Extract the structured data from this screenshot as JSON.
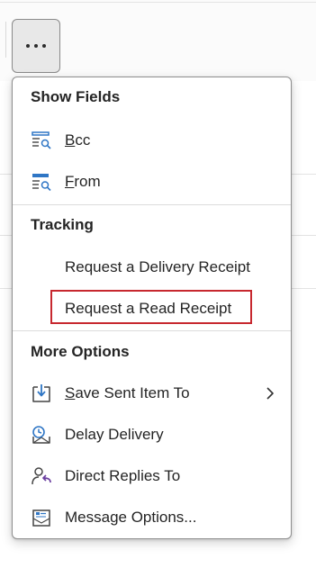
{
  "toolbar": {
    "more_icon": "ellipsis-icon"
  },
  "menu": {
    "sections": {
      "show_fields": {
        "title": "Show Fields",
        "items": {
          "bcc": {
            "mnemonic": "B",
            "rest": "cc",
            "icon": "bcc-fields-icon"
          },
          "from": {
            "mnemonic": "F",
            "rest": "rom",
            "icon": "from-fields-icon"
          }
        }
      },
      "tracking": {
        "title": "Tracking",
        "items": {
          "delivery_receipt": {
            "label": "Request a Delivery Receipt"
          },
          "read_receipt": {
            "label": "Request a Read Receipt",
            "highlighted": true
          }
        }
      },
      "more_options": {
        "title": "More Options",
        "items": {
          "save_sent": {
            "mnemonic": "S",
            "rest": "ave Sent Item To",
            "icon": "save-sent-folder-icon",
            "has_submenu": true
          },
          "delay_delivery": {
            "label": "Delay Delivery",
            "icon": "delay-clock-icon"
          },
          "direct_replies": {
            "label": "Direct Replies To",
            "icon": "direct-replies-icon"
          },
          "message_options": {
            "label": "Message Options...",
            "icon": "message-options-icon"
          }
        }
      }
    }
  },
  "colors": {
    "icon_blue": "#2f76c5",
    "icon_purple": "#6b3fa0",
    "highlight_red": "#c7282f",
    "text": "#242424"
  }
}
